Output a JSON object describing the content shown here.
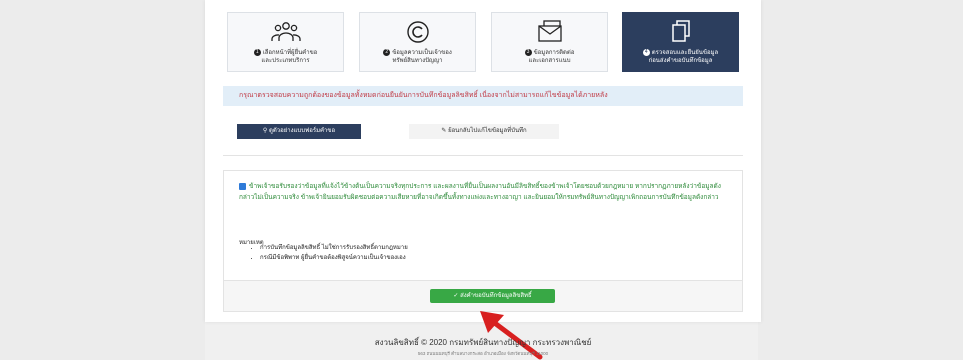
{
  "steps": [
    {
      "num": "1",
      "label_line1": "เลือกหน้าที่ผู้ยื่นคำขอ",
      "label_line2": "และประเภทบริการ",
      "icon": "users-icon",
      "active": false
    },
    {
      "num": "2",
      "label_line1": "ข้อมูลความเป็นเจ้าของ",
      "label_line2": "ทรัพย์สินทางปัญญา",
      "icon": "copyright-icon",
      "active": false
    },
    {
      "num": "3",
      "label_line1": "ข้อมูลการติดต่อ",
      "label_line2": "และเอกสารแนบ",
      "icon": "mail-icon",
      "active": false
    },
    {
      "num": "4",
      "label_line1": "ตรวจสอบและยืนยันข้อมูล",
      "label_line2": "ก่อนส่งคำขอบันทึกข้อมูล",
      "icon": "copy-icon",
      "active": true
    }
  ],
  "notice": "กรุณาตรวจสอบความถูกต้องของข้อมูลทั้งหมดก่อนยืนยันการบันทึกข้อมูลลิขสิทธิ์ เนื่องจากไม่สามารถแก้ไขข้อมูลได้ภายหลัง",
  "buttons": {
    "check": "ดูตัวอย่างแบบฟอร์มคำขอ",
    "edit": "ย้อนกลับไปแก้ไขข้อมูลที่บันทึก",
    "submit": "ส่งคำขอบันทึกข้อมูลลิขสิทธิ์"
  },
  "consent_text": "ข้าพเจ้าขอรับรองว่าข้อมูลที่แจ้งไว้ข้างต้นเป็นความจริงทุกประการ และผลงานที่ยื่นเป็นผลงานอันมีลิขสิทธิ์ของข้าพเจ้าโดยชอบด้วยกฎหมาย หากปรากฏภายหลังว่าข้อมูลดังกล่าวไม่เป็นความจริง ข้าพเจ้ายินยอมรับผิดชอบต่อความเสียหายที่อาจเกิดขึ้นทั้งทางแพ่งและทางอาญา และยินยอมให้กรมทรัพย์สินทางปัญญาเพิกถอนการบันทึกข้อมูลดังกล่าว",
  "notes_title": "หมายเหตุ",
  "notes": [
    "การบันทึกข้อมูลลิขสิทธิ์ ไม่ใช่การรับรองสิทธิ์ตามกฎหมาย",
    "กรณีมีข้อพิพาท ผู้ยื่นคำขอต้องพิสูจน์ความเป็นเจ้าของเอง"
  ],
  "footer": {
    "copyright": "สงวนลิขสิทธิ์ © 2020 กรมทรัพย์สินทางปัญญา กระทรวงพาณิชย์",
    "subline": "563 ถนนนนทบุรี ตำบลบางกระสอ อำเภอเมือง จังหวัดนนทบุรี 11000"
  },
  "colors": {
    "navy": "#2c3e5e",
    "green": "#38a845",
    "notice_red": "#c03a45",
    "consent_green": "#2e8b3a",
    "arrow_red": "#d82020"
  }
}
